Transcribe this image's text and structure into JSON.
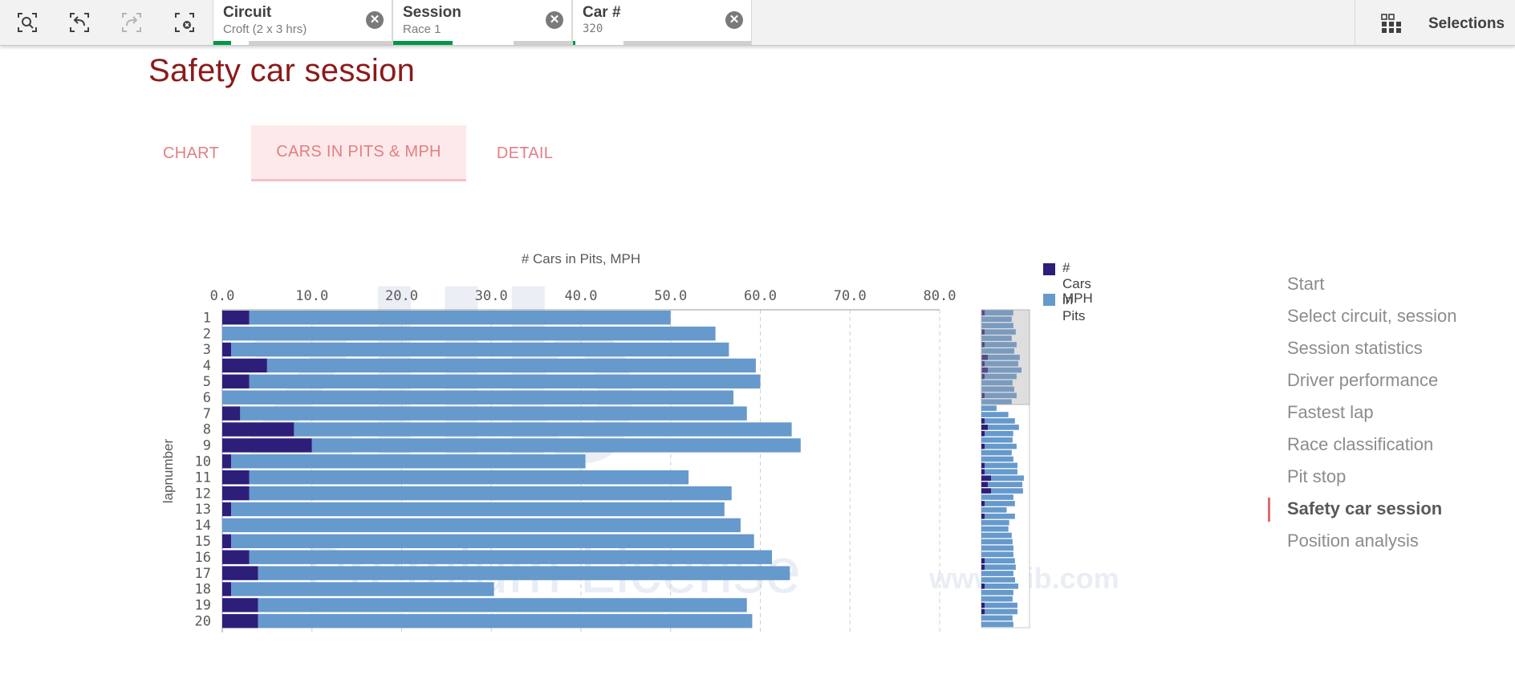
{
  "toolbar": {
    "icons": [
      "smart-search-icon",
      "step-back-icon",
      "step-forward-icon",
      "clear-selections-icon"
    ],
    "chips": [
      {
        "field": "Circuit",
        "value": "Croft (2 x 3 hrs)"
      },
      {
        "field": "Session",
        "value": "Race 1"
      },
      {
        "field": "Car #",
        "value": "320"
      }
    ],
    "selections_label": "Selections"
  },
  "page": {
    "title": "Safety car session",
    "tabs": [
      "CHART",
      "CARS IN PITS & MPH",
      "DETAIL"
    ],
    "active_tab": "CARS IN PITS & MPH"
  },
  "nav": {
    "items": [
      "Start",
      "Select circuit, session",
      "Session statistics",
      "Driver performance",
      "Fastest lap",
      "Race classification",
      "Pit stop",
      "Safety car session",
      "Position analysis"
    ],
    "active": "Safety car session"
  },
  "watermark": {
    "large": "zlib",
    "license": "Premium License",
    "url": "www.zlib.com"
  },
  "colors": {
    "cars_in_pits": "#2d1e7a",
    "mph": "#6699cc",
    "title": "#8b1a1a",
    "tab_text": "#e27f85",
    "tab_active_bg": "#fde9e9",
    "accent": "#e06a72",
    "green": "#009845"
  },
  "chart_data": {
    "type": "bar",
    "orientation": "horizontal",
    "stacked": true,
    "title": "# Cars in Pits,   MPH",
    "ylabel": "lapnumber",
    "xlim": [
      0,
      80
    ],
    "xticks": [
      "0.0",
      "10.0",
      "20.0",
      "30.0",
      "40.0",
      "50.0",
      "60.0",
      "70.0",
      "80.0"
    ],
    "categories": [
      "1",
      "2",
      "3",
      "4",
      "5",
      "6",
      "7",
      "8",
      "9",
      "10",
      "11",
      "12",
      "13",
      "14",
      "15",
      "16",
      "17",
      "18",
      "19",
      "20"
    ],
    "series": [
      {
        "name": "# Cars in Pits",
        "values": [
          3,
          0,
          1,
          5,
          3,
          0,
          2,
          8,
          10,
          1,
          3,
          3,
          1,
          0,
          1,
          3,
          4,
          1,
          4,
          4
        ]
      },
      {
        "name": "MPH",
        "values": [
          47,
          55,
          55.5,
          54.5,
          57,
          57,
          56.5,
          55.5,
          54.5,
          39.5,
          49,
          53.8,
          55,
          57.8,
          58.3,
          58.3,
          59.3,
          29.3,
          54.5,
          55.1
        ]
      }
    ],
    "legend": {
      "position": "top-right",
      "entries": [
        "# Cars in Pits",
        "MPH"
      ]
    },
    "grid": true,
    "minimap": {
      "cars_in_pits": [
        1,
        0,
        0,
        1,
        0,
        1,
        0,
        2,
        1,
        2,
        1,
        0,
        0,
        1,
        0,
        0,
        0,
        1,
        2,
        1,
        0,
        1,
        0,
        0,
        1,
        1,
        3,
        2,
        3,
        0,
        1,
        0,
        1,
        0,
        0,
        0,
        0,
        0,
        0,
        1,
        1,
        0,
        0,
        1,
        0,
        0,
        1,
        1,
        0,
        0
      ],
      "mph": [
        34,
        36,
        38,
        37,
        36,
        38,
        39,
        38,
        40,
        40,
        38,
        37,
        39,
        38,
        36,
        18,
        32,
        36,
        37,
        34,
        37,
        38,
        36,
        38,
        39,
        39,
        39,
        41,
        38,
        38,
        36,
        30,
        36,
        33,
        32,
        36,
        37,
        38,
        38,
        36,
        37,
        38,
        40,
        40,
        38,
        37,
        39,
        39,
        37,
        38
      ]
    }
  }
}
